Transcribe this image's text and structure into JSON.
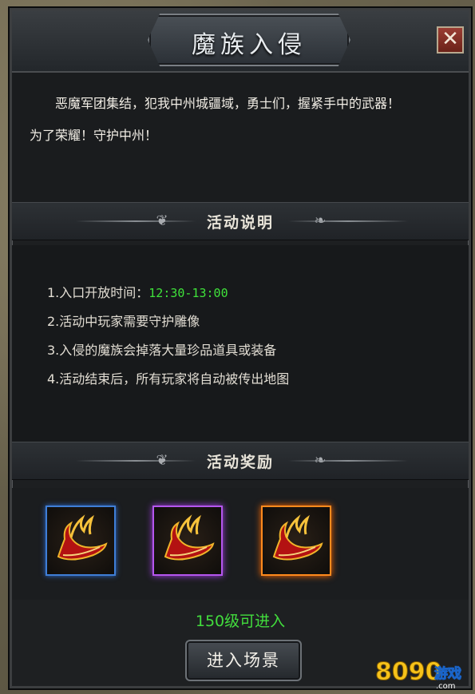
{
  "window": {
    "title": "魔族入侵",
    "close_glyph": "✕"
  },
  "intro": {
    "line1": "恶魔军团集结，犯我中州城疆域，勇士们，握紧手中的武器！",
    "line2": "为了荣耀！守护中州！"
  },
  "info_section": {
    "title": "活动说明",
    "rules": [
      {
        "prefix": "1.入口开放时间：",
        "time": "12:30-13:00"
      },
      {
        "prefix": "2.活动中玩家需要守护雕像"
      },
      {
        "prefix": "3.入侵的魔族会掉落大量珍品道具或装备"
      },
      {
        "prefix": "4.活动结束后，所有玩家将自动被传出地图"
      }
    ]
  },
  "rewards_section": {
    "title": "活动奖励",
    "items": [
      {
        "icon": "winged-boots-icon",
        "rarity": "blue",
        "color": "#3f7ed6"
      },
      {
        "icon": "winged-boots-icon",
        "rarity": "purple",
        "color": "#b556ee"
      },
      {
        "icon": "winged-boots-icon",
        "rarity": "orange",
        "color": "#ff8a1d"
      }
    ]
  },
  "footer": {
    "level_requirement": "150级可进入",
    "enter_button": "进入场景"
  },
  "watermark": {
    "brand": "8090",
    "suffix": "游戏",
    "domain": ".com"
  },
  "colors": {
    "accent_green": "#42dd3d",
    "time_green": "#3fe23a",
    "close_red": "#9a3d33"
  }
}
